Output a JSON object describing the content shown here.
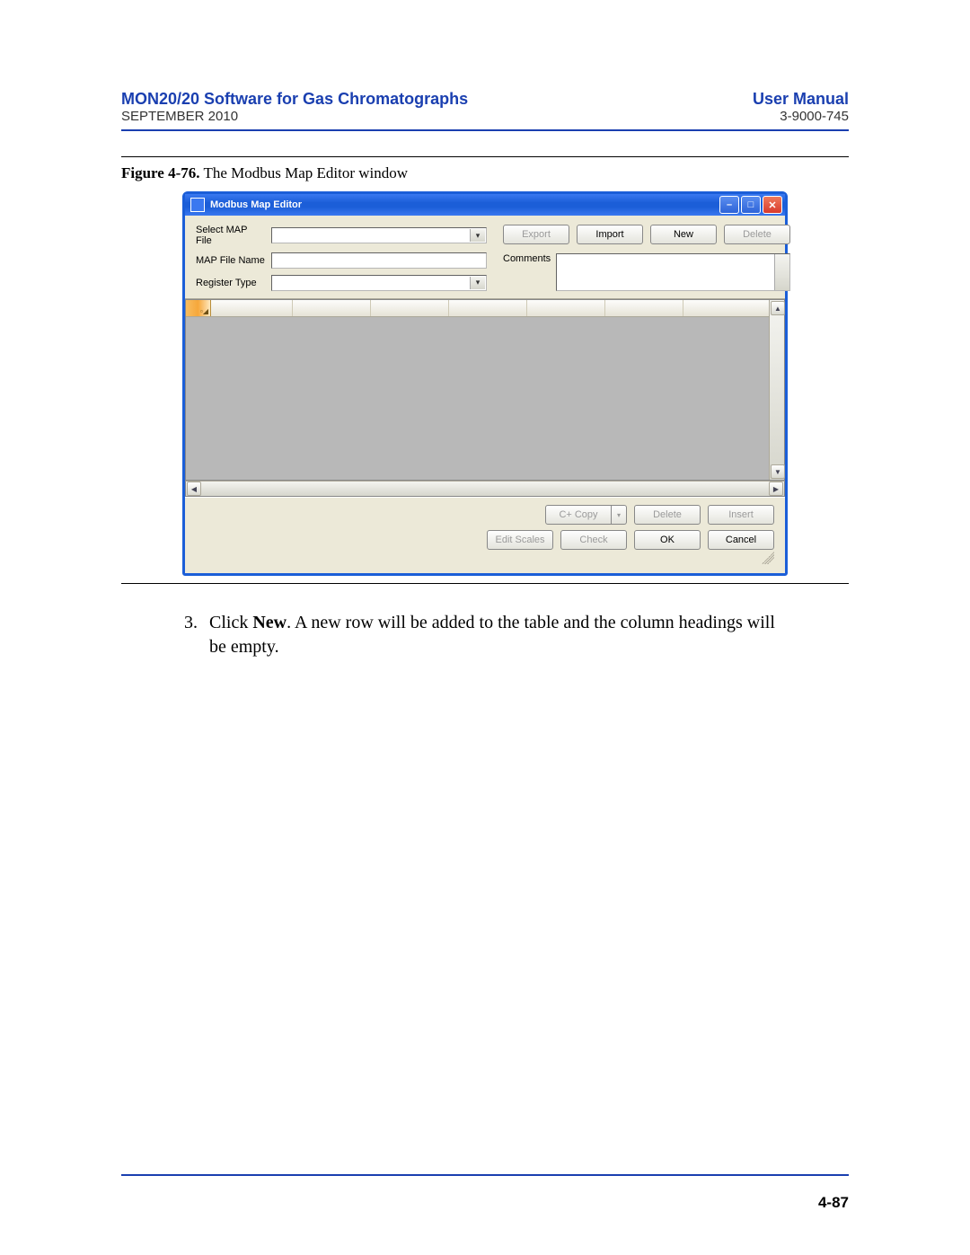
{
  "header": {
    "title_left": "MON20/20 Software for Gas Chromatographs",
    "title_right": "User Manual",
    "sub_left": "SEPTEMBER 2010",
    "sub_right": "3-9000-745"
  },
  "figure": {
    "number": "Figure 4-76.",
    "caption": "The Modbus Map Editor window"
  },
  "dialog": {
    "title": "Modbus Map Editor",
    "labels": {
      "select_map": "Select MAP File",
      "map_name": "MAP File Name",
      "reg_type": "Register Type",
      "comments": "Comments"
    },
    "top_buttons": {
      "export": "Export",
      "import": "Import",
      "new": "New",
      "delete": "Delete"
    },
    "mid_buttons": {
      "ccopy": "C+ Copy",
      "delete": "Delete",
      "insert": "Insert"
    },
    "bot_buttons": {
      "edit_scales": "Edit Scales",
      "check": "Check",
      "ok": "OK",
      "cancel": "Cancel"
    },
    "grid_index_mark": "▫◢"
  },
  "instruction": {
    "number": "3.",
    "text_pre": "Click ",
    "bold": "New",
    "text_post": ".  A new row will be added to the table and the column headings will be empty."
  },
  "page_number": "4-87"
}
